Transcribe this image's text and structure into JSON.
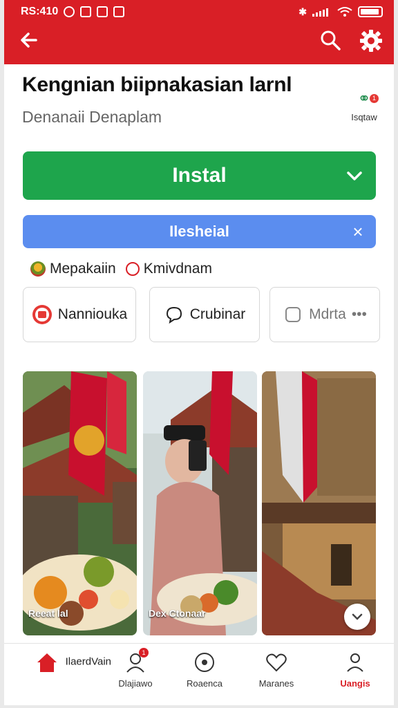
{
  "status_bar": {
    "time": "RS:410"
  },
  "header": {
    "title": "Kengnian biipnakasian larnl",
    "subtitle": "Denanaii Denaplam",
    "side_action": {
      "label": "Isqtaw",
      "icon": "share-icon",
      "badge": "1"
    }
  },
  "install_button": {
    "label": "Instal",
    "icon": "chevron-down-icon",
    "color": "#1ea54c"
  },
  "banner": {
    "label": "Ilesheial",
    "icon": "close-icon",
    "color": "#5b8def"
  },
  "options": [
    {
      "label": "Mepakaiin",
      "icon": "flag-icon"
    },
    {
      "label": "Kmivdnam",
      "icon": "radio-icon"
    }
  ],
  "chips": [
    {
      "label": "Nanniouka",
      "icon": "red-badge-icon"
    },
    {
      "label": "Crubinar",
      "icon": "chat-icon"
    },
    {
      "label": "Mdrta",
      "icon": "checkbox-icon",
      "more": "•••"
    }
  ],
  "gallery": {
    "items": [
      {
        "caption": "Reeat lal"
      },
      {
        "caption": "Dex Ctonaar"
      },
      {
        "caption": ""
      }
    ]
  },
  "bottom_nav": [
    {
      "label": "IlaerdVain",
      "icon": "home-icon"
    },
    {
      "label": "Dlajiawo",
      "icon": "person-icon",
      "badge": "1"
    },
    {
      "label": "Roaenca",
      "icon": "circle-icon"
    },
    {
      "label": "Maranes",
      "icon": "heart-icon"
    },
    {
      "label": "Uangis",
      "icon": "profile-icon"
    }
  ],
  "colors": {
    "brand_red": "#d91f26",
    "accent_green": "#1ea54c",
    "accent_blue": "#5b8def"
  }
}
